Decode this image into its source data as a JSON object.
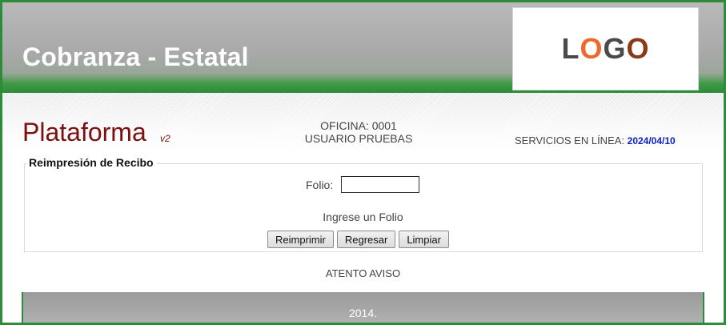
{
  "header": {
    "title": "Cobranza - Estatal",
    "logo": {
      "letters": [
        "L",
        "O",
        "G",
        "O"
      ]
    }
  },
  "platform": {
    "name": "Plataforma",
    "version": "v2"
  },
  "office": {
    "office_line": "OFICINA: 0001",
    "user_line": "USUARIO PRUEBAS"
  },
  "services": {
    "label": "SERVICIOS EN LÍNEA:",
    "date": "2024/04/10"
  },
  "reprint": {
    "legend": "Reimpresión de Recibo",
    "folio_label": "Folio:",
    "folio_value": "",
    "message": "Ingrese un Folio",
    "buttons": {
      "reprint": "Reimprimir",
      "back": "Regresar",
      "clear": "Limpiar"
    }
  },
  "notice": "ATENTO AVISO",
  "footer": {
    "text": "2014."
  },
  "colors": {
    "border_green": "#2e8b3a",
    "title_red": "#7a1010",
    "date_blue": "#0a1ec8",
    "logo_orange": "#ee6a2c",
    "logo_brown": "#8a3a18"
  }
}
